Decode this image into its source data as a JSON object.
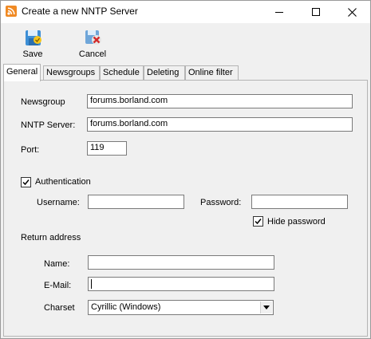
{
  "window": {
    "title": "Create a new NNTP Server",
    "title_icon": "rss-feed-icon"
  },
  "toolbar": {
    "save_label": "Save",
    "cancel_label": "Cancel"
  },
  "tabs": [
    {
      "label": "General",
      "active": true
    },
    {
      "label": "Newsgroups",
      "active": false
    },
    {
      "label": "Schedule",
      "active": false
    },
    {
      "label": "Deleting",
      "active": false
    },
    {
      "label": "Online filter",
      "active": false
    }
  ],
  "general": {
    "newsgroup_label": "Newsgroup",
    "newsgroup_value": "forums.borland.com",
    "nntp_server_label": "NNTP Server:",
    "nntp_server_value": "forums.borland.com",
    "port_label": "Port:",
    "port_value": "119",
    "authentication_label": "Authentication",
    "authentication_checked": true,
    "username_label": "Username:",
    "username_value": "",
    "password_label": "Password:",
    "password_value": "",
    "hide_password_label": "Hide password",
    "hide_password_checked": true,
    "return_address_label": "Return address",
    "name_label": "Name:",
    "name_value": "",
    "email_label": "E-Mail:",
    "email_value": "",
    "charset_label": "Charset",
    "charset_value": "Cyrillic (Windows)"
  }
}
